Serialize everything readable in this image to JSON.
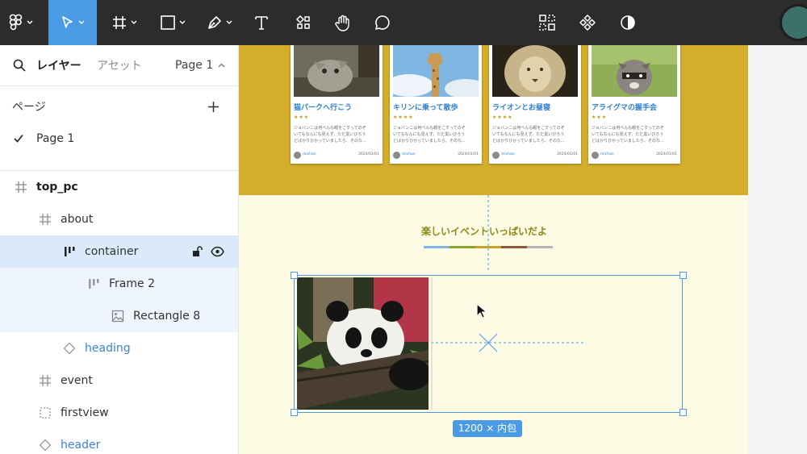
{
  "toolbar": {
    "tools": [
      {
        "name": "main-menu",
        "icon": "figma-logo-icon"
      },
      {
        "name": "move-tool",
        "icon": "cursor-icon",
        "active": true
      },
      {
        "name": "frame-tool",
        "icon": "frame-icon"
      },
      {
        "name": "shape-tool",
        "icon": "rectangle-icon"
      },
      {
        "name": "pen-tool",
        "icon": "pen-icon"
      },
      {
        "name": "text-tool",
        "icon": "text-icon"
      },
      {
        "name": "resources-tool",
        "icon": "resources-icon"
      },
      {
        "name": "hand-tool",
        "icon": "hand-icon"
      },
      {
        "name": "comment-tool",
        "icon": "comment-icon"
      }
    ],
    "center_tools": [
      "grid-icon",
      "component-icon",
      "contrast-icon"
    ],
    "accent": "#4b9ae6"
  },
  "panel": {
    "tab_layers": "レイヤー",
    "tab_assets": "アセット",
    "page_selector": "Page 1",
    "pages_heading": "ページ",
    "pages": [
      {
        "label": "Page 1",
        "current": true
      }
    ],
    "layers": [
      {
        "label": "top_pc",
        "icon": "frame-icon",
        "depth": 0,
        "bold": true
      },
      {
        "label": "about",
        "icon": "frame-icon",
        "depth": 1
      },
      {
        "label": "container",
        "icon": "autolayout-icon",
        "depth": 2,
        "selected": true
      },
      {
        "label": "Frame 2",
        "icon": "autolayout-icon",
        "depth": 3
      },
      {
        "label": "Rectangle 8",
        "icon": "image-icon",
        "depth": 4
      },
      {
        "label": "heading",
        "icon": "component-instance-icon",
        "depth": 2,
        "component": true
      },
      {
        "label": "event",
        "icon": "frame-icon",
        "depth": 1
      },
      {
        "label": "firstview",
        "icon": "section-icon",
        "depth": 1
      },
      {
        "label": "header",
        "icon": "component-instance-icon",
        "depth": 1,
        "component": true
      }
    ]
  },
  "canvas": {
    "cards": [
      {
        "title": "猫パークへ行こう",
        "stars": "★★★",
        "body": [
          "ジョバンニは何べんも眼をこすってのぞ",
          "いてもなんにも見えず、ただ黒いびろう",
          "どばかりひかっていましたら、そのな..."
        ],
        "author": "michan",
        "date": "2024/01/01",
        "photo": "cat"
      },
      {
        "title": "キリンに乗って散歩",
        "stars": "★★★★",
        "body": [
          "ジョバンニは何べんも眼をこすってのぞ",
          "いてもなんにも見えず、ただ黒いびろう",
          "どばかりひかっていましたら、そのな..."
        ],
        "author": "michan",
        "date": "2024/01/01",
        "photo": "giraffe"
      },
      {
        "title": "ライオンとお昼寝",
        "stars": "★★★★",
        "body": [
          "ジョバンニは何べんも眼をこすってのぞ",
          "いてもなんにも見えず、ただ黒いびろう",
          "どばかりひかっていましたら、そのな..."
        ],
        "author": "michan",
        "date": "2024/01/01",
        "photo": "lion"
      },
      {
        "title": "アライグマの握手会",
        "stars": "★★★",
        "body": [
          "ジョバンニは何べんも眼をこすってのぞ",
          "いてもなんにも見えず、ただ黒いびろう",
          "どばかりひかっていましたら、そのな..."
        ],
        "author": "michan",
        "date": "2024/01/01",
        "photo": "raccoon"
      }
    ],
    "event_heading": "楽しいイベントいっぱいだよ",
    "heading_bar_colors": [
      "#7fb4e8",
      "#8aa332",
      "#c8a22a",
      "#8b5a3c",
      "#b5b5b5"
    ],
    "size_label": "1200 × 内包",
    "colors": {
      "gold": "#d3ad2b",
      "cream": "#fefbe5",
      "card_title": "#2e7fd0",
      "heading": "#8a8a19"
    }
  }
}
